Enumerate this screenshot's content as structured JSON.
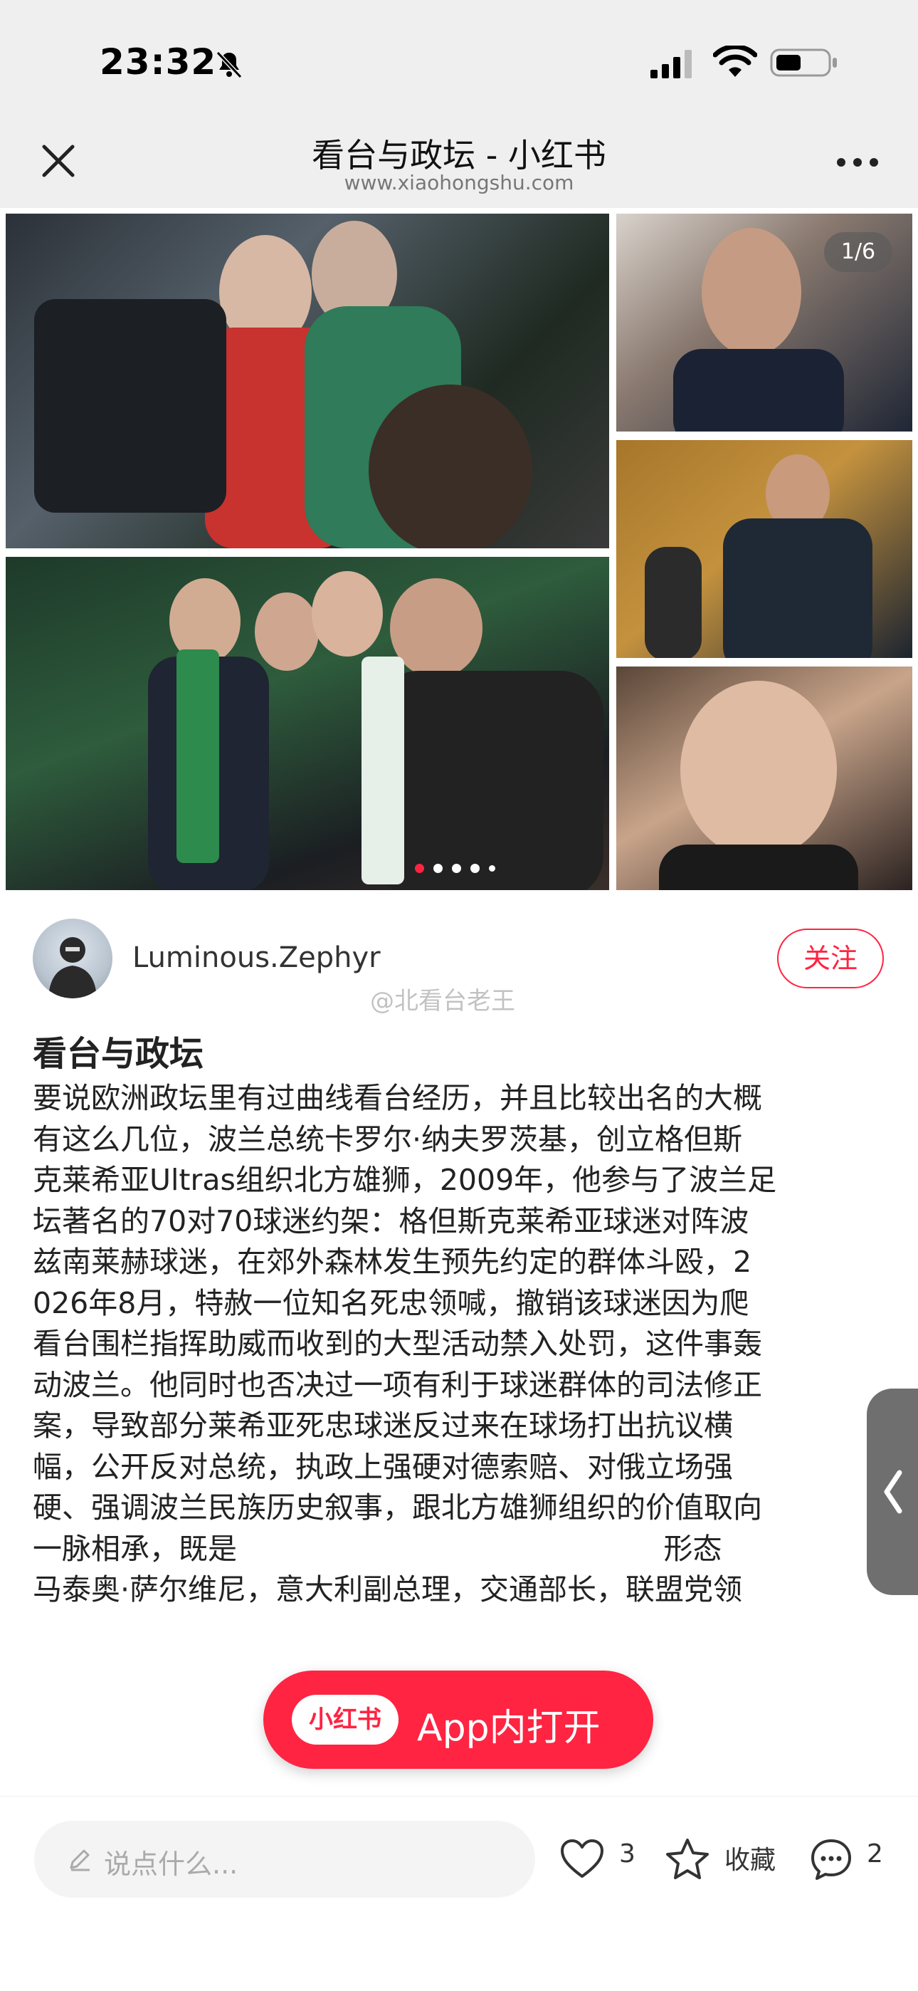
{
  "status_bar": {
    "time": "23:32",
    "icons": [
      "bell-mute-icon",
      "signal-icon",
      "wifi-icon",
      "battery-icon"
    ]
  },
  "header": {
    "title": "看台与政坛 - 小红书",
    "url": "www.xiaohongshu.com"
  },
  "gallery": {
    "counter": "1/6",
    "page_count": 5,
    "active_page": 1
  },
  "author": {
    "name": "Luminous.Zephyr",
    "follow_label": "关注"
  },
  "watermark": "@北看台老王",
  "post": {
    "title": "看台与政坛",
    "lines": [
      "要说欧洲政坛里有过曲线看台经历，并且比较出名的大概",
      "有这么几位，波兰总统卡罗尔·纳夫罗茨基，创立格但斯",
      "克莱希亚Ultras组织北方雄狮，2009年，他参与了波兰足",
      "坛著名的70对70球迷约架：格但斯克莱希亚球迷对阵波",
      "兹南莱赫球迷，在郊外森林发生预先约定的群体斗殴，2",
      "026年8月，特赦一位知名死忠领喊，撤销该球迷因为爬",
      "看台围栏指挥助威而收到的大型活动禁入处罚，这件事轰",
      "动波兰。他同时也否决过一项有利于球迷群体的司法修正",
      "案，导致部分莱希亚死忠球迷反过来在球场打出抗议横",
      "幅，公开反对总统，执政上强硬对德索赔、对俄立场强",
      "硬、强调波兰民族历史叙事，跟北方雄狮组织的价值取向",
      "一脉相承，既是                                              形态",
      "马泰奥·萨尔维尼，意大利副总理，交通部长，联盟党领"
    ]
  },
  "open_in_app": {
    "logo": "小红书",
    "label": "App内打开"
  },
  "bottom_bar": {
    "comment_placeholder": "说点什么...",
    "likes": "3",
    "collect_label": "收藏",
    "comments": "2"
  },
  "colors": {
    "accent": "#ff2442",
    "header_bg": "#efefef"
  }
}
